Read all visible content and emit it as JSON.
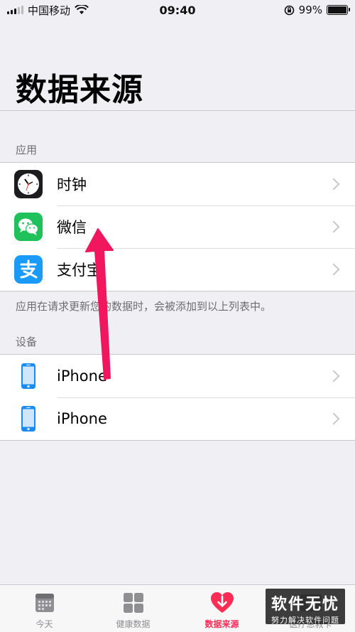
{
  "status_bar": {
    "carrier": "中国移动",
    "time": "09:40",
    "battery": "99%",
    "battery_level": 0.99
  },
  "page_title": "数据来源",
  "apps_section": {
    "header": "应用",
    "items": [
      {
        "label": "时钟",
        "icon": "clock-icon"
      },
      {
        "label": "微信",
        "icon": "wechat-icon"
      },
      {
        "label": "支付宝",
        "icon": "alipay-icon"
      }
    ],
    "footer": "应用在请求更新您的数据时，会被添加到以上列表中。"
  },
  "devices_section": {
    "header": "设备",
    "items": [
      {
        "label": "iPhone",
        "icon": "iphone-icon"
      },
      {
        "label": "iPhone",
        "icon": "iphone-icon"
      }
    ]
  },
  "tab_bar": {
    "tabs": [
      {
        "label": "今天",
        "icon": "calendar-icon",
        "active": false
      },
      {
        "label": "健康数据",
        "icon": "grid-icon",
        "active": false
      },
      {
        "label": "数据来源",
        "icon": "heart-download-icon",
        "active": true
      },
      {
        "label": "医疗急救卡",
        "icon": "medical-id-icon",
        "active": false
      }
    ]
  },
  "watermark": {
    "title": "软件无忧",
    "subtitle": "努力解决软件问题"
  },
  "colors": {
    "accent": "#ff2d55",
    "wechat": "#1fc15a",
    "alipay": "#1a9bfc",
    "iphone": "#1a8cf0",
    "arrow": "#f0175e"
  }
}
